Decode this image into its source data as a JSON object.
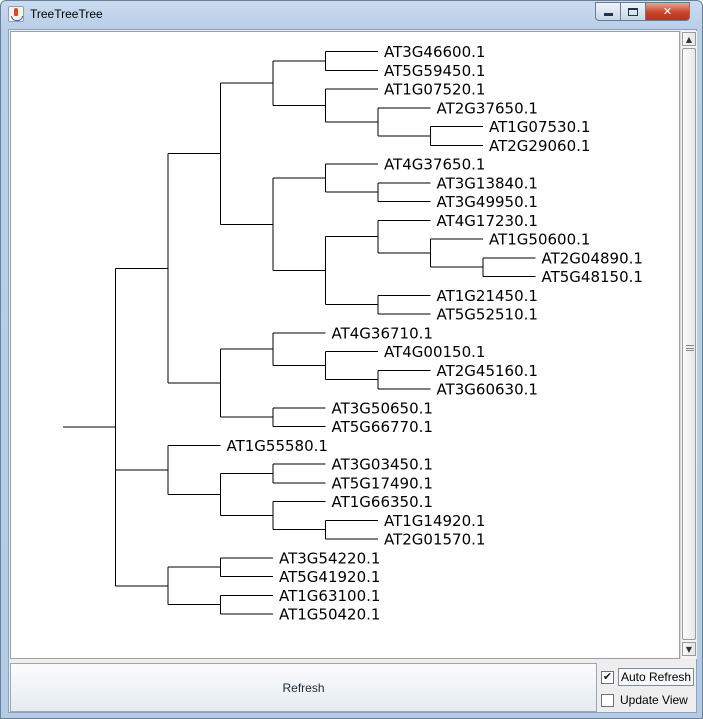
{
  "window": {
    "title": "TreeTreeTree",
    "controls": {
      "minimize": "minimize",
      "maximize": "maximize",
      "close": "✕"
    }
  },
  "icons": {
    "app": "java-cup-icon",
    "checkmark": "✔",
    "scroll_up": "▲",
    "scroll_down": "▼"
  },
  "tree": {
    "leaves": [
      {
        "label": "AT3G46600.1",
        "depth": 4
      },
      {
        "label": "AT5G59450.1",
        "depth": 4
      },
      {
        "label": "AT1G07520.1",
        "depth": 4
      },
      {
        "label": "AT2G37650.1",
        "depth": 5
      },
      {
        "label": "AT1G07530.1",
        "depth": 6
      },
      {
        "label": "AT2G29060.1",
        "depth": 6
      },
      {
        "label": "AT4G37650.1",
        "depth": 4
      },
      {
        "label": "AT3G13840.1",
        "depth": 5
      },
      {
        "label": "AT3G49950.1",
        "depth": 5
      },
      {
        "label": "AT4G17230.1",
        "depth": 5
      },
      {
        "label": "AT1G50600.1",
        "depth": 6
      },
      {
        "label": "AT2G04890.1",
        "depth": 7
      },
      {
        "label": "AT5G48150.1",
        "depth": 7
      },
      {
        "label": "AT1G21450.1",
        "depth": 5
      },
      {
        "label": "AT5G52510.1",
        "depth": 5
      },
      {
        "label": "AT4G36710.1",
        "depth": 3
      },
      {
        "label": "AT4G00150.1",
        "depth": 4
      },
      {
        "label": "AT2G45160.1",
        "depth": 5
      },
      {
        "label": "AT3G60630.1",
        "depth": 5
      },
      {
        "label": "AT3G50650.1",
        "depth": 3
      },
      {
        "label": "AT5G66770.1",
        "depth": 3
      },
      {
        "label": "AT1G55580.1",
        "depth": 1
      },
      {
        "label": "AT3G03450.1",
        "depth": 3
      },
      {
        "label": "AT5G17490.1",
        "depth": 3
      },
      {
        "label": "AT1G66350.1",
        "depth": 3
      },
      {
        "label": "AT1G14920.1",
        "depth": 4
      },
      {
        "label": "AT2G01570.1",
        "depth": 4
      },
      {
        "label": "AT3G54220.1",
        "depth": 2
      },
      {
        "label": "AT5G41920.1",
        "depth": 2
      },
      {
        "label": "AT1G63100.1",
        "depth": 2
      },
      {
        "label": "AT1G50420.1",
        "depth": 2
      }
    ],
    "line_color": "#000000",
    "newick": "((((((0,1),(2,(3,(4,5)))),((6,(7,8)),((9,(10,(11,12))),(13,14)))),((15,(16,(17,18))),(19,20))),(21,((22,23),(24,(25,26)))),((27,28),(29,30))))"
  },
  "controls": {
    "refresh_label": "Refresh",
    "auto_refresh_label": "Auto Refresh",
    "auto_refresh_checked": true,
    "update_view_label": "Update View",
    "update_view_checked": false
  }
}
